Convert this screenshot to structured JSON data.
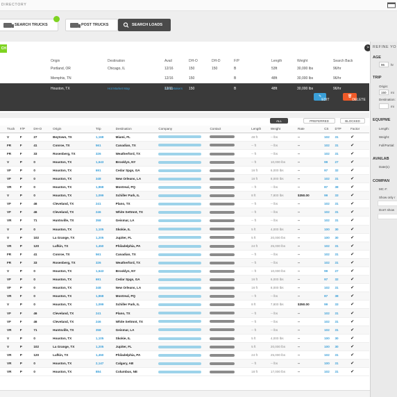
{
  "header": {
    "directory_label": "DIRECTORY"
  },
  "nav": {
    "search_trucks": "SEARCH TRUCKS",
    "post_trucks": "POST TRUCKS",
    "search_loads": "SEARCH LOADS"
  },
  "green_button": "CH",
  "toggle": ">",
  "saved_search": {
    "headers": [
      "Origin",
      "Destination",
      "Avail",
      "DH-O",
      "DH-D",
      "F/P",
      "Length",
      "Weight",
      "Search Back"
    ],
    "rows": [
      [
        "Portland, OR",
        "Chicago, IL",
        "12/16",
        "150",
        "150",
        "B",
        "53ft",
        "30,000 lbs",
        "96/hr"
      ],
      [
        "Memphis, TN",
        "",
        "12/16",
        "150",
        "",
        "B",
        "48ft",
        "30,000 lbs",
        "96/hr"
      ],
      [
        "Houston, TX",
        "",
        "12/11",
        "150",
        "",
        "B",
        "48ft",
        "30,000 lbs",
        "96/hr"
      ]
    ],
    "links": [
      "Hot Market Map",
      "Lane Makers"
    ],
    "edit": "EDIT",
    "delete": "DELETE"
  },
  "filters": {
    "all": "ALL",
    "preferred": "PREFERRED",
    "blocked": "BLOCKED"
  },
  "table": {
    "headers": [
      "Truck",
      "F/P",
      "DH-O",
      "Origin",
      "Trip",
      "Destination",
      "Company",
      "Contact",
      "Length",
      "Weight",
      "Rate",
      "CS",
      "DTP",
      "Factor"
    ],
    "rows": [
      [
        "V",
        "F",
        "27",
        "Beytown, TX",
        "1,168",
        "Miami, FL",
        "48 ft",
        "-- lbs",
        "--",
        "102",
        "31"
      ],
      [
        "FR",
        "F",
        "41",
        "Conroe, TX",
        "561",
        "Canadian, TX",
        "-- ft",
        "-- lbs",
        "--",
        "102",
        "31"
      ],
      [
        "FR",
        "F",
        "33",
        "Rosenberg, TX",
        "326",
        "Weatherford, TX",
        "-- ft",
        "-- lbs",
        "--",
        "102",
        "31"
      ],
      [
        "V",
        "P",
        "0",
        "Houston, TX",
        "1,643",
        "Brooklyn, NY",
        "-- ft",
        "10,000 lbs",
        "--",
        "99",
        "27"
      ],
      [
        "VF",
        "P",
        "0",
        "Houston, TX",
        "691",
        "Cedar Spgs, GA",
        "16 ft",
        "6,000 lbs",
        "--",
        "97",
        "32"
      ],
      [
        "VF",
        "P",
        "0",
        "Houston, TX",
        "348",
        "New Orleans, LA",
        "16 ft",
        "8,000 lbs",
        "--",
        "102",
        "31"
      ],
      [
        "VR",
        "F",
        "0",
        "Houston, TX",
        "1,868",
        "Montreal, PQ",
        "-- ft",
        "-- lbs",
        "--",
        "87",
        "38"
      ],
      [
        "V",
        "P",
        "0",
        "Houston, TX",
        "1,099",
        "Schiller Park, IL",
        "8 ft",
        "7,800 lbs",
        "$350.00",
        "99",
        "33"
      ],
      [
        "VF",
        "F",
        "46",
        "Cleveland, TX",
        "241",
        "Plano, TX",
        "-- ft",
        "-- lbs",
        "--",
        "102",
        "31"
      ],
      [
        "VF",
        "F",
        "46",
        "Cleveland, TX",
        "246",
        "White Settmnt, TX",
        "-- ft",
        "-- lbs",
        "--",
        "102",
        "31"
      ],
      [
        "VR",
        "F",
        "71",
        "Huntsville, TX",
        "358",
        "Geismar, LA",
        "-- ft",
        "-- lbs",
        "--",
        "102",
        "31"
      ],
      [
        "V",
        "P",
        "0",
        "Houston, TX",
        "1,105",
        "Skokie, IL",
        "5 ft",
        "4,000 lbs",
        "--",
        "100",
        "30"
      ],
      [
        "V",
        "P",
        "102",
        "La Grange, TX",
        "1,205",
        "Jupiter, FL",
        "5 ft",
        "20,000 lbs",
        "--",
        "100",
        "30"
      ],
      [
        "VR",
        "P",
        "120",
        "Lufkin, TX",
        "1,450",
        "Philadelphia, PA",
        "24 ft",
        "25,000 lbs",
        "--",
        "102",
        "31"
      ],
      [
        "FR",
        "F",
        "41",
        "Conroe, TX",
        "561",
        "Canadian, TX",
        "-- ft",
        "-- lbs",
        "--",
        "102",
        "31"
      ],
      [
        "FR",
        "F",
        "33",
        "Rosenberg, TX",
        "326",
        "Weatherford, TX",
        "-- ft",
        "-- lbs",
        "--",
        "102",
        "31"
      ],
      [
        "V",
        "P",
        "0",
        "Houston, TX",
        "1,643",
        "Brooklyn, NY",
        "-- ft",
        "10,000 lbs",
        "--",
        "99",
        "27"
      ],
      [
        "VF",
        "P",
        "0",
        "Houston, TX",
        "691",
        "Cedar Spgs, GA",
        "16 ft",
        "6,000 lbs",
        "--",
        "97",
        "32"
      ],
      [
        "VF",
        "P",
        "0",
        "Houston, TX",
        "348",
        "New Orleans, LA",
        "16 ft",
        "8,000 lbs",
        "--",
        "102",
        "31"
      ],
      [
        "VR",
        "F",
        "0",
        "Houston, TX",
        "1,868",
        "Montreal, PQ",
        "-- ft",
        "-- lbs",
        "--",
        "87",
        "38"
      ],
      [
        "V",
        "P",
        "0",
        "Houston, TX",
        "1,099",
        "Schiller Park, IL",
        "8 ft",
        "7,800 lbs",
        "$350.00",
        "99",
        "33"
      ],
      [
        "VF",
        "F",
        "46",
        "Cleveland, TX",
        "241",
        "Plano, TX",
        "-- ft",
        "-- lbs",
        "--",
        "102",
        "31"
      ],
      [
        "VF",
        "F",
        "46",
        "Cleveland, TX",
        "246",
        "White Settmnt, TX",
        "-- ft",
        "-- lbs",
        "--",
        "102",
        "31"
      ],
      [
        "VR",
        "F",
        "71",
        "Huntsville, TX",
        "358",
        "Geismar, LA",
        "-- ft",
        "-- lbs",
        "--",
        "102",
        "31"
      ],
      [
        "V",
        "P",
        "0",
        "Houston, TX",
        "1,105",
        "Skokie, IL",
        "5 ft",
        "4,000 lbs",
        "--",
        "100",
        "30"
      ],
      [
        "V",
        "P",
        "102",
        "La Grange, TX",
        "1,205",
        "Jupiter, FL",
        "5 ft",
        "20,000 lbs",
        "--",
        "100",
        "30"
      ],
      [
        "VR",
        "P",
        "120",
        "Lufkin, TX",
        "1,450",
        "Philadelphia, PA",
        "24 ft",
        "25,000 lbs",
        "--",
        "102",
        "31"
      ],
      [
        "VR",
        "P",
        "0",
        "Houston, TX",
        "2,147",
        "Calgary, AB",
        "-- ft",
        "-- lbs",
        "--",
        "100",
        "31"
      ],
      [
        "VR",
        "P",
        "0",
        "Houston, TX",
        "884",
        "Columbus, NE",
        "18 ft",
        "17,000 lbs",
        "--",
        "102",
        "31"
      ]
    ]
  },
  "sidebar": {
    "title": "REFINE YO",
    "age": "AGE",
    "age_value": "96",
    "age_unit": "hr",
    "trip": "TRIP",
    "origin": "Origin:",
    "origin_value": "150",
    "origin_unit": "mi",
    "destination": "Destination:",
    "destination_unit": "mi",
    "equipment": "EQUIPME",
    "length": "Length:",
    "weight": "Weight:",
    "full_partial": "Full/Partial:",
    "availability": "AVAILAB",
    "dates": "Date(s):",
    "company": "COMPAN",
    "mc": "MC #:",
    "show_only": "Show only r",
    "dont_show": "Don't show"
  }
}
